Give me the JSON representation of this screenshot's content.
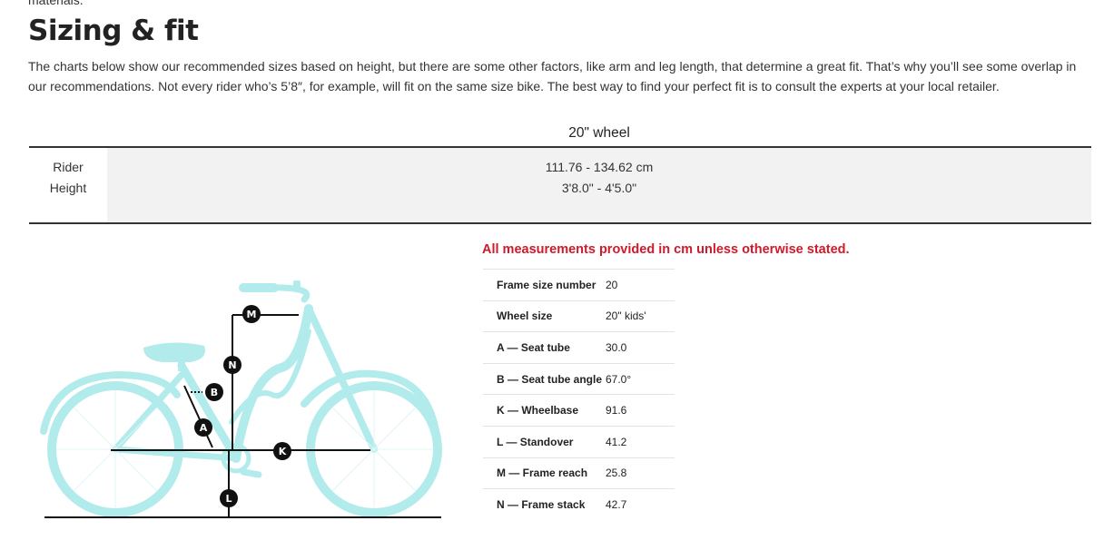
{
  "intro_cutoff": "materials.",
  "section": {
    "title": "Sizing & fit",
    "intro": "The charts below show our recommended sizes based on height, but there are some other factors, like arm and leg length, that determine a great fit. That’s why you’ll see some overlap in our recommendations. Not every rider who’s 5’8″, for example, will fit on the same size bike. The best way to find your perfect fit is to consult the experts at your local retailer."
  },
  "size_table": {
    "column_header": "20\" wheel",
    "row_label_line1": "Rider",
    "row_label_line2": "Height",
    "height_cm": "111.76 - 134.62 cm",
    "height_ft": "3'8.0\" - 4'5.0\""
  },
  "geometry": {
    "note": "All measurements provided in cm unless otherwise stated.",
    "rows": [
      {
        "label": "Frame size number",
        "value": "20"
      },
      {
        "label": "Wheel size",
        "value": "20\" kids'"
      },
      {
        "label": "A — Seat tube",
        "value": "30.0"
      },
      {
        "label": "B — Seat tube angle",
        "value": "67.0°"
      },
      {
        "label": "K — Wheelbase",
        "value": "91.6"
      },
      {
        "label": "L — Standover",
        "value": "41.2"
      },
      {
        "label": "M — Frame reach",
        "value": "25.8"
      },
      {
        "label": "N — Frame stack",
        "value": "42.7"
      }
    ]
  },
  "diagram": {
    "bike_color": "#b2ebeb",
    "markers": {
      "a": "A",
      "b": "B",
      "k": "K",
      "l": "L",
      "m": "M",
      "n": "N"
    }
  }
}
